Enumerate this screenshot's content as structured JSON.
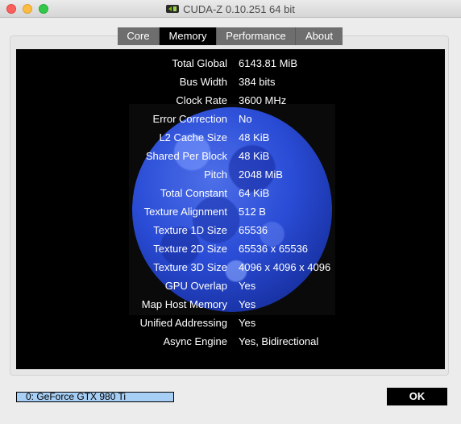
{
  "window": {
    "title": "CUDA-Z 0.10.251 64 bit",
    "icon": "cuda-z-app-icon"
  },
  "tabs": [
    {
      "label": "Core",
      "active": false
    },
    {
      "label": "Memory",
      "active": true
    },
    {
      "label": "Performance",
      "active": false
    },
    {
      "label": "About",
      "active": false
    }
  ],
  "memory": {
    "rows": [
      {
        "label": "Total Global",
        "value": "6143.81 MiB"
      },
      {
        "label": "Bus Width",
        "value": "384 bits"
      },
      {
        "label": "Clock Rate",
        "value": "3600 MHz"
      },
      {
        "label": "Error Correction",
        "value": "No"
      },
      {
        "label": "L2 Cache Size",
        "value": "48 KiB"
      },
      {
        "label": "Shared Per Block",
        "value": "48 KiB"
      },
      {
        "label": "Pitch",
        "value": "2048 MiB"
      },
      {
        "label": "Total Constant",
        "value": "64 KiB"
      },
      {
        "label": "Texture Alignment",
        "value": "512 B"
      },
      {
        "label": "Texture 1D Size",
        "value": "65536"
      },
      {
        "label": "Texture 2D Size",
        "value": "65536 x 65536"
      },
      {
        "label": "Texture 3D Size",
        "value": "4096 x 4096 x 4096"
      },
      {
        "label": "GPU Overlap",
        "value": "Yes"
      },
      {
        "label": "Map Host Memory",
        "value": "Yes"
      },
      {
        "label": "Unified Addressing",
        "value": "Yes"
      },
      {
        "label": "Async Engine",
        "value": "Yes, Bidirectional"
      }
    ]
  },
  "device_select": {
    "selected": "0: GeForce GTX 980 Ti"
  },
  "ok_button": {
    "label": "OK"
  },
  "colors": {
    "content_background": "#000000",
    "moon": "#2a4cd6",
    "selection": "#a7cff5"
  }
}
